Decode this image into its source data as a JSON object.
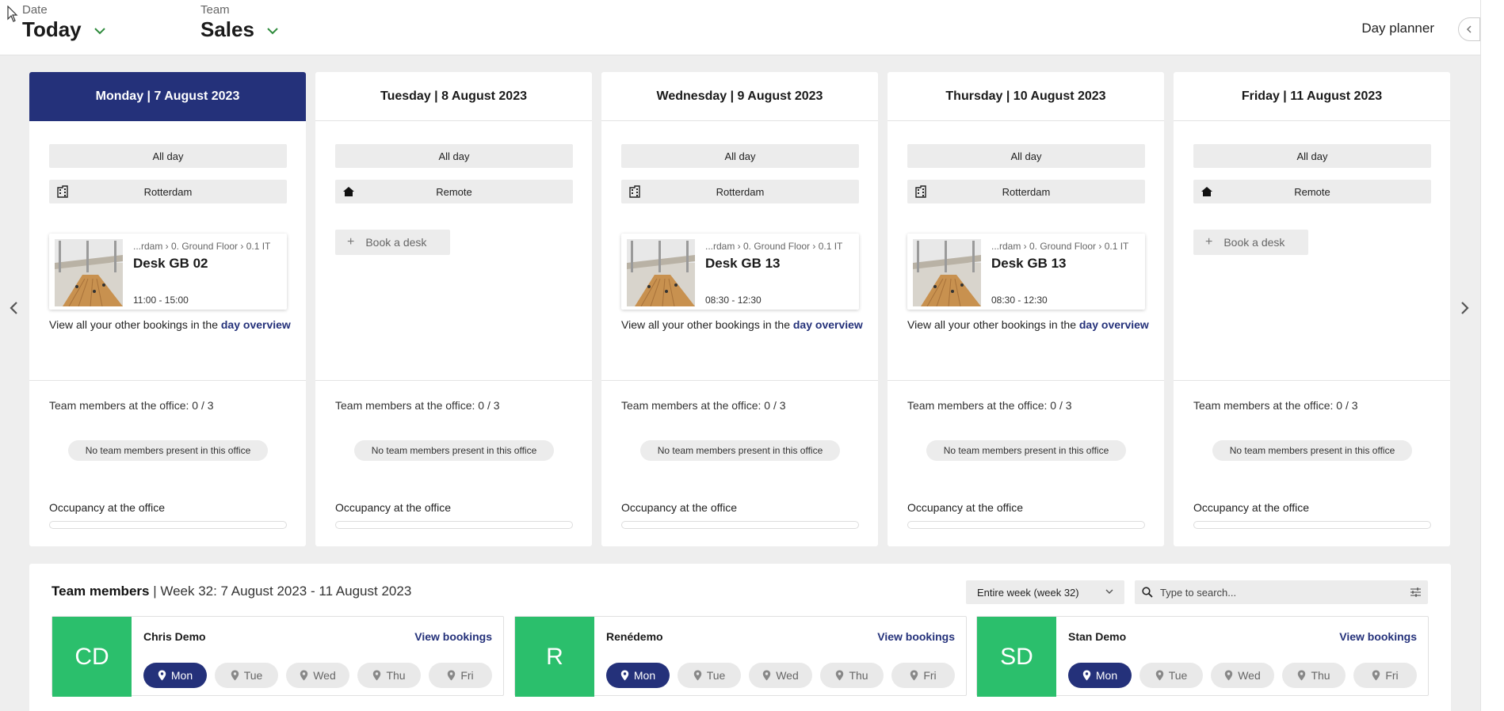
{
  "header": {
    "date_label": "Date",
    "date_value": "Today",
    "team_label": "Team",
    "team_value": "Sales",
    "title": "Day planner",
    "collapse_icon": "chevron-left-icon"
  },
  "navigation": {
    "prev_icon": "chevron-left-icon",
    "next_icon": "chevron-right-icon"
  },
  "days": [
    {
      "title": "Monday | 7 August 2023",
      "active": true,
      "period": "All day",
      "location": "Rotterdam",
      "location_icon": "building-icon",
      "booking": {
        "path": "...rdam  ›  0. Ground Floor  ›  0.1 IT",
        "desk": "Desk GB 02",
        "time": "11:00 - 15:00"
      },
      "overview_text": "View all your other bookings in the",
      "overview_link": "day overview",
      "team_members_text": "Team members at the office: 0 / 3",
      "no_members_text": "No team members present in this office",
      "occupancy_label": "Occupancy at the office",
      "occupancy": 0
    },
    {
      "title": "Tuesday | 8 August 2023",
      "active": false,
      "period": "All day",
      "location": "Remote",
      "location_icon": "home-icon",
      "book_desk_label": "Book a desk",
      "team_members_text": "Team members at the office: 0 / 3",
      "no_members_text": "No team members present in this office",
      "occupancy_label": "Occupancy at the office",
      "occupancy": 0
    },
    {
      "title": "Wednesday | 9 August 2023",
      "active": false,
      "period": "All day",
      "location": "Rotterdam",
      "location_icon": "building-icon",
      "booking": {
        "path": "...rdam  ›  0. Ground Floor  ›  0.1 IT",
        "desk": "Desk GB 13",
        "time": "08:30 - 12:30"
      },
      "overview_text": "View all your other bookings in the",
      "overview_link": "day overview",
      "team_members_text": "Team members at the office: 0 / 3",
      "no_members_text": "No team members present in this office",
      "occupancy_label": "Occupancy at the office",
      "occupancy": 0
    },
    {
      "title": "Thursday | 10 August 2023",
      "active": false,
      "period": "All day",
      "location": "Rotterdam",
      "location_icon": "building-icon",
      "booking": {
        "path": "...rdam  ›  0. Ground Floor  ›  0.1 IT",
        "desk": "Desk GB 13",
        "time": "08:30 - 12:30"
      },
      "overview_text": "View all your other bookings in the",
      "overview_link": "day overview",
      "team_members_text": "Team members at the office: 0 / 3",
      "no_members_text": "No team members present in this office",
      "occupancy_label": "Occupancy at the office",
      "occupancy": 0
    },
    {
      "title": "Friday | 11 August 2023",
      "active": false,
      "period": "All day",
      "location": "Remote",
      "location_icon": "home-icon",
      "book_desk_label": "Book a desk",
      "team_members_text": "Team members at the office: 0 / 3",
      "no_members_text": "No team members present in this office",
      "occupancy_label": "Occupancy at the office",
      "occupancy": 0
    }
  ],
  "team_panel": {
    "title_bold": "Team members",
    "title_rest": " | Week 32: 7 August 2023 - 11 August 2023",
    "week_select": "Entire week (week 32)",
    "search_placeholder": "Type to search...",
    "members": [
      {
        "initials": "CD",
        "name": "Chris Demo",
        "link": "View bookings",
        "days": [
          "Mon",
          "Tue",
          "Wed",
          "Thu",
          "Fri"
        ],
        "active_day": "Mon"
      },
      {
        "initials": "R",
        "name": "Renédemo",
        "link": "View bookings",
        "days": [
          "Mon",
          "Tue",
          "Wed",
          "Thu",
          "Fri"
        ],
        "active_day": "Mon"
      },
      {
        "initials": "SD",
        "name": "Stan Demo",
        "link": "View bookings",
        "days": [
          "Mon",
          "Tue",
          "Wed",
          "Thu",
          "Fri"
        ],
        "active_day": "Mon"
      }
    ]
  },
  "colors": {
    "primary": "#24317a",
    "avatar": "#2bbf6c",
    "accent_chevron": "#2e8b3c"
  }
}
